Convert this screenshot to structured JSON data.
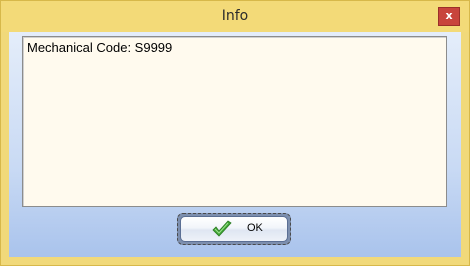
{
  "window": {
    "title": "Info",
    "close_label": "x"
  },
  "message": {
    "text": "Mechanical Code: S9999"
  },
  "buttons": {
    "ok_label": "OK",
    "ok_icon": "checkmark-icon"
  },
  "colors": {
    "title_bar": "#f3da78",
    "close_button": "#c8443c",
    "message_background": "#fffaee",
    "checkmark": "#3fa534"
  }
}
